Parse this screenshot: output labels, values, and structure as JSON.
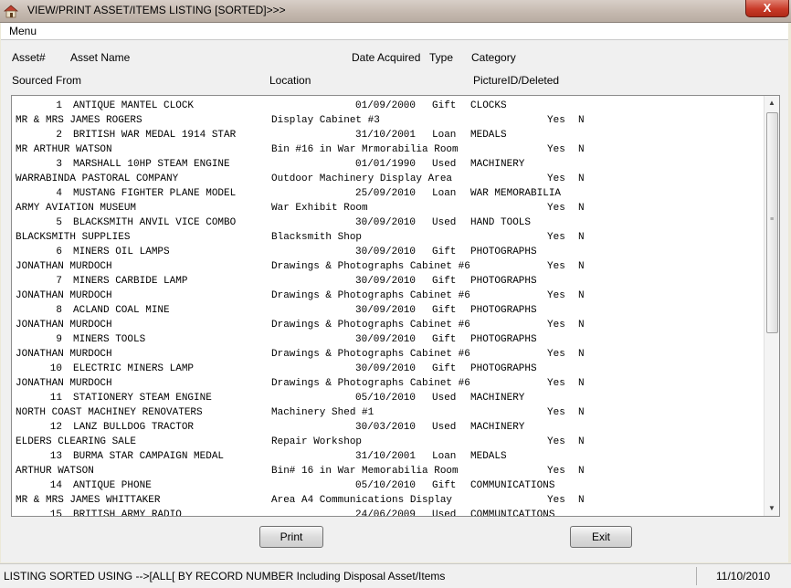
{
  "window": {
    "title": "VIEW/PRINT ASSET/ITEMS LISTING [SORTED]>>>",
    "close_label": "X"
  },
  "menu": {
    "label": "Menu"
  },
  "headers": {
    "asset_no": "Asset#",
    "asset_name": "Asset Name",
    "date_acquired": "Date Acquired",
    "type": "Type",
    "category": "Category",
    "sourced_from": "Sourced From",
    "location": "Location",
    "picture_deleted": "PictureID/Deleted"
  },
  "records": [
    {
      "no": "1",
      "name": "ANTIQUE MANTEL CLOCK",
      "date": "01/09/2000",
      "type": "Gift",
      "category": "CLOCKS",
      "source": "MR & MRS JAMES ROGERS",
      "location": "Display Cabinet #3",
      "picture": "Yes",
      "deleted": "N"
    },
    {
      "no": "2",
      "name": "BRITISH WAR MEDAL 1914 STAR",
      "date": "31/10/2001",
      "type": "Loan",
      "category": "MEDALS",
      "source": "MR ARTHUR WATSON",
      "location": "Bin #16 in War Mrmorabilia Room",
      "picture": "Yes",
      "deleted": "N"
    },
    {
      "no": "3",
      "name": "MARSHALL 10HP STEAM ENGINE",
      "date": "01/01/1990",
      "type": "Used",
      "category": "MACHINERY",
      "source": "WARRABINDA PASTORAL COMPANY",
      "location": "Outdoor Machinery Display Area",
      "picture": "Yes",
      "deleted": "N"
    },
    {
      "no": "4",
      "name": "MUSTANG FIGHTER PLANE MODEL",
      "date": "25/09/2010",
      "type": "Loan",
      "category": "WAR MEMORABILIA",
      "source": "ARMY AVIATION MUSEUM",
      "location": "War Exhibit Room",
      "picture": "Yes",
      "deleted": "N"
    },
    {
      "no": "5",
      "name": "BLACKSMITH ANVIL VICE COMBO",
      "date": "30/09/2010",
      "type": "Used",
      "category": "HAND TOOLS",
      "source": "BLACKSMITH SUPPLIES",
      "location": "Blacksmith Shop",
      "picture": "Yes",
      "deleted": "N"
    },
    {
      "no": "6",
      "name": "MINERS OIL LAMPS",
      "date": "30/09/2010",
      "type": "Gift",
      "category": "PHOTOGRAPHS",
      "source": "JONATHAN MURDOCH",
      "location": "Drawings & Photographs Cabinet #6",
      "picture": "Yes",
      "deleted": "N"
    },
    {
      "no": "7",
      "name": "MINERS CARBIDE LAMP",
      "date": "30/09/2010",
      "type": "Gift",
      "category": "PHOTOGRAPHS",
      "source": "JONATHAN MURDOCH",
      "location": "Drawings & Photographs Cabinet #6",
      "picture": "Yes",
      "deleted": "N"
    },
    {
      "no": "8",
      "name": "ACLAND COAL MINE",
      "date": "30/09/2010",
      "type": "Gift",
      "category": "PHOTOGRAPHS",
      "source": "JONATHAN MURDOCH",
      "location": "Drawings & Photographs Cabinet #6",
      "picture": "Yes",
      "deleted": "N"
    },
    {
      "no": "9",
      "name": "MINERS TOOLS",
      "date": "30/09/2010",
      "type": "Gift",
      "category": "PHOTOGRAPHS",
      "source": "JONATHAN MURDOCH",
      "location": "Drawings & Photographs Cabinet #6",
      "picture": "Yes",
      "deleted": "N"
    },
    {
      "no": "10",
      "name": "ELECTRIC MINERS LAMP",
      "date": "30/09/2010",
      "type": "Gift",
      "category": "PHOTOGRAPHS",
      "source": "JONATHAN MURDOCH",
      "location": "Drawings & Photographs Cabinet #6",
      "picture": "Yes",
      "deleted": "N"
    },
    {
      "no": "11",
      "name": "STATIONERY STEAM ENGINE",
      "date": "05/10/2010",
      "type": "Used",
      "category": "MACHINERY",
      "source": "NORTH COAST MACHINEY RENOVATERS",
      "location": "Machinery Shed #1",
      "picture": "Yes",
      "deleted": "N"
    },
    {
      "no": "12",
      "name": "LANZ BULLDOG TRACTOR",
      "date": "30/03/2010",
      "type": "Used",
      "category": "MACHINERY",
      "source": "ELDERS CLEARING SALE",
      "location": "Repair Workshop",
      "picture": "Yes",
      "deleted": "N"
    },
    {
      "no": "13",
      "name": "BURMA STAR CAMPAIGN MEDAL",
      "date": "31/10/2001",
      "type": "Loan",
      "category": "MEDALS",
      "source": "ARTHUR WATSON",
      "location": "Bin# 16 in War Memorabilia Room",
      "picture": "Yes",
      "deleted": "N"
    },
    {
      "no": "14",
      "name": "ANTIQUE PHONE",
      "date": "05/10/2010",
      "type": "Gift",
      "category": "COMMUNICATIONS",
      "source": "MR & MRS JAMES WHITTAKER",
      "location": "Area A4 Communications Display",
      "picture": "Yes",
      "deleted": "N"
    },
    {
      "no": "15",
      "name": "BRITISH ARMY RADIO",
      "date": "24/06/2009",
      "type": "Used",
      "category": "COMMUNICATIONS",
      "source": "",
      "location": "",
      "picture": "",
      "deleted": ""
    }
  ],
  "buttons": {
    "print": "Print",
    "exit": "Exit"
  },
  "status": {
    "text": "LISTING SORTED USING -->[ALL[ BY RECORD NUMBER Including Disposal Asset/Items",
    "date": "11/10/2010"
  },
  "colors": {
    "titlebar": "#c4b8ae",
    "close": "#c83a28",
    "background": "#f0f0f0"
  }
}
